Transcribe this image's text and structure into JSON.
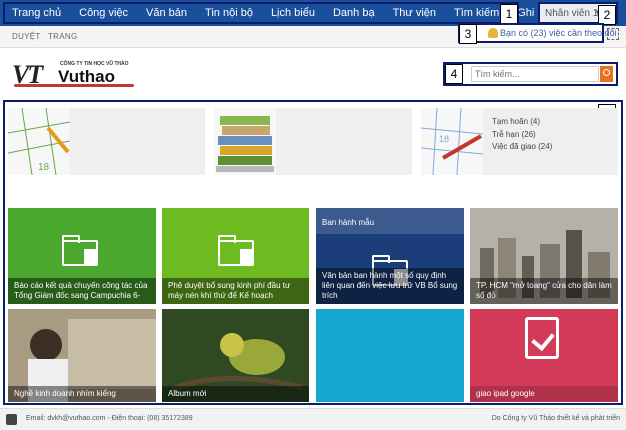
{
  "nav": {
    "items": [
      "Trang chủ",
      "Công việc",
      "Văn bản",
      "Tin nội bộ",
      "Lịch biểu",
      "Danh bạ",
      "Thư viện",
      "Tìm kiếm",
      "Ghi chú"
    ],
    "user": "Nhân viên 1"
  },
  "subbar": {
    "tabs": [
      "DUYỆT",
      "TRANG"
    ]
  },
  "notification": "Bạn có (23) việc cần theo dõi",
  "logo": {
    "short": "VT",
    "company": "CÔNG TY TIN HỌC VŨ THẢO",
    "brand": "Vuthao"
  },
  "search": {
    "placeholder": "Tìm kiếm..."
  },
  "callouts": [
    "1",
    "2",
    "3",
    "4",
    "5"
  ],
  "status": {
    "items": [
      "Tạm hoãn (4)",
      "Trễ hạn (26)",
      "Việc đã giao (24)"
    ]
  },
  "tiles": [
    {
      "caption": "Báo cáo kết quả chuyến công tác của Tổng Giám đốc sang Campuchia 6-",
      "color": "#4aa82e"
    },
    {
      "caption": "Phê duyệt bổ sung kinh phí đầu tư máy nén khí thứ để",
      "extra": "Kế hoạch",
      "color": "#6dbb21"
    },
    {
      "header": "Ban hành mẫu",
      "caption": "Văn bản ban hành một số quy định liên quan đến việc lưu trữ VB Bổ sung trích",
      "color": "#1b3e7a"
    },
    {
      "caption": "TP. HCM \"mở toang\" cửa cho dân làm sổ đỏ",
      "color": "#8a8a8a"
    },
    {
      "caption": "Nghề kinh doanh nhím kiểng",
      "color": "#7a6a55"
    },
    {
      "caption": "Album mới",
      "color": "#3d5a2a"
    },
    {
      "caption": "",
      "color": "#16a7cf"
    },
    {
      "caption": "giao ipad google",
      "color": "#d23a58"
    }
  ],
  "footer": {
    "contact": "Email: dvkh@vuthao.com - Điện thoại: (08) 35172389",
    "credit": "Do Công ty Vũ Thảo thiết kế và phát triển"
  }
}
